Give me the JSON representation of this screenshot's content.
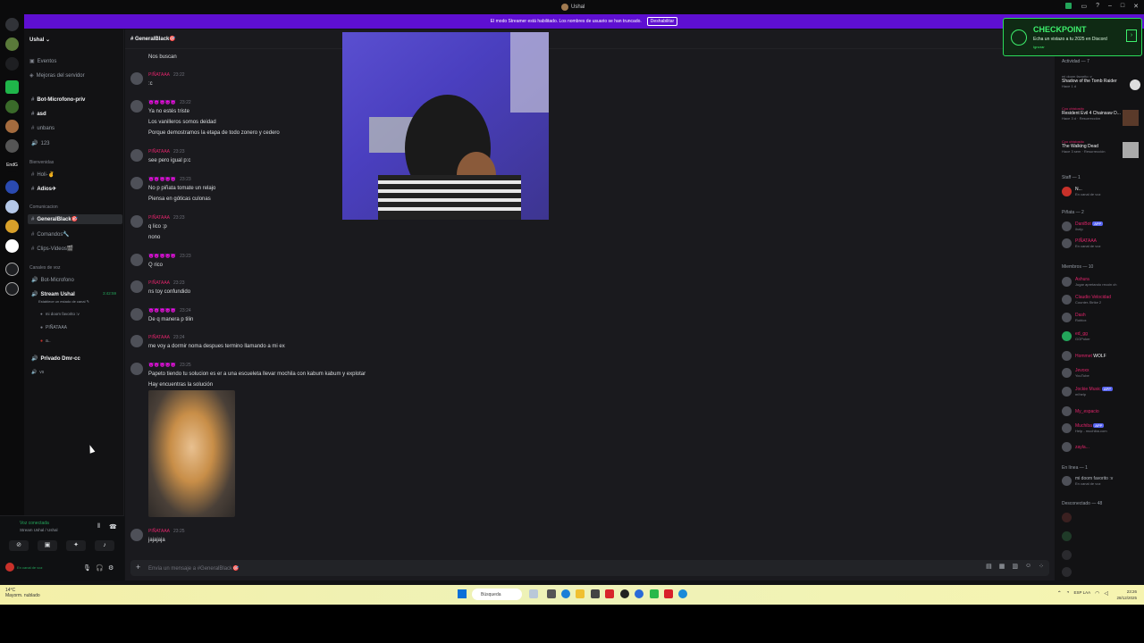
{
  "window": {
    "title": "Ushal"
  },
  "banner": {
    "text": "El modo Streamer está habilitado. Los nombres de usuario se han truncado.",
    "button": "Deshabilitar"
  },
  "server": {
    "name": "Ushal"
  },
  "channels": {
    "top": [
      {
        "label": "Eventos"
      },
      {
        "label": "Mejoras del servidor"
      }
    ],
    "text_top": [
      {
        "label": "Bot-Microfono-priv"
      },
      {
        "label": "asd"
      },
      {
        "label": "unbans"
      },
      {
        "label": "123"
      }
    ],
    "cat_bienvenidas": "Bienvenidas",
    "bienvenidas": [
      {
        "label": "Holi-✌"
      },
      {
        "label": "Adios✈"
      }
    ],
    "cat_comunicacion": "Comunicacion",
    "comunicacion": [
      {
        "label": "GeneralBlack🎯"
      },
      {
        "label": "Comandos🔧"
      },
      {
        "label": "Clips-Videos🎬"
      }
    ],
    "cat_voz": "Canales de voz",
    "voz": [
      {
        "label": "Bot-Microfono"
      },
      {
        "label": "Stream Ushal",
        "time": "3:42:59"
      }
    ],
    "voz_status": "Establece un estado de canal ✎",
    "voz_users": [
      {
        "label": "mi doom favorito :v"
      },
      {
        "label": "PIÑATAAA"
      },
      {
        "label": "a.."
      }
    ],
    "private": {
      "label": "Privado Dmr-cc"
    },
    "vs": "vs"
  },
  "voice_panel": {
    "status": "Voz conectada",
    "channel": "Stream Ushal / Ushal",
    "user_status": "En canal de voz"
  },
  "chat": {
    "channel_title": "GeneralBlack🎯",
    "composer_placeholder": "Envía un mensaje a #GeneralBlack🎯",
    "messages": [
      {
        "text": "Nos buscan"
      },
      {
        "name": "PIÑATAAA",
        "time": "23:22",
        "text": ":c"
      },
      {
        "name": "😈😈😈😈😈",
        "time": "23:22",
        "lines": [
          "Ya no estés triste",
          "Los vanilleros somos deidad",
          "Porque demostramos la etapa de todo zonero y cedero"
        ]
      },
      {
        "name": "PIÑATAAA",
        "time": "23:23",
        "text": "see pero igual p:c"
      },
      {
        "name": "😈😈😈😈😈",
        "time": "23:23",
        "lines": [
          "No p piñata tomate un relajo",
          "Piensa en góticas culonas"
        ]
      },
      {
        "name": "PIÑATAAA",
        "time": "23:23",
        "lines": [
          "q lico :p",
          "nono"
        ]
      },
      {
        "name": "😈😈😈😈😈",
        "time": "23:23",
        "text": "Q rico"
      },
      {
        "name": "PIÑATAAA",
        "time": "23:23",
        "text": "ns toy confundido"
      },
      {
        "name": "😈😈😈😈😈",
        "time": "23:24",
        "text": "De q manera p tilin"
      },
      {
        "name": "PIÑATAAA",
        "time": "23:24",
        "text": "me voy a dormir noma despues termino llamando a mi ex"
      },
      {
        "name": "😈😈😈😈😈",
        "time": "23:25",
        "lines": [
          "Papeto tiendo tu solucion es er a una escueleta llevar mochila con kabum kabum y explotar",
          "Hay encuentras la solución"
        ]
      },
      {
        "name": "PIÑATAAA",
        "time": "23:25",
        "text": "jajajaja"
      }
    ]
  },
  "checkpoint": {
    "title": "CHECKPOINT",
    "subtitle": "Echa un vistazo a tu 2025 en Discord",
    "dismiss": "Ignorar",
    "arrow": "›"
  },
  "members": {
    "activity_head": "Actividad — 7",
    "activities": [
      {
        "user": "mi doom favorito :v",
        "title": "Shadow of the Tomb Raider",
        "sub": "Hace 1 d"
      },
      {
        "user": "Cyo chistosito",
        "title": "Resident Evil 4 Chainsaw D...",
        "sub": "Hace 3 d · Resurrección"
      },
      {
        "user": "Cyo chistosito",
        "title": "The Walking Dead",
        "sub": "Hace 3 sem · Resurrección"
      }
    ],
    "staff_head": "Staff — 1",
    "staff": [
      {
        "name": "N...",
        "sub": "En canal de voz"
      }
    ],
    "pinata_head": "Piñata — 2",
    "pinata": [
      {
        "name": "DaniBot",
        "badge": "APP",
        "sub": "/help"
      },
      {
        "name": "PIÑATAAA",
        "sub": "En canal de voz"
      }
    ],
    "miembros_head": "Miembros — 10",
    "miembros": [
      {
        "name": "Ashura",
        "sub": "Jugar apretando recoin ch"
      },
      {
        "name": "Claudio Velocidad",
        "sub": "Counter-Strike 2"
      },
      {
        "name": "Dash",
        "sub": "Roblox"
      },
      {
        "name": "ed_gg",
        "sub": "GGPoker"
      },
      {
        "name": "Hommet",
        "sub": "WOLF"
      },
      {
        "name": "Jevoxx",
        "sub": "YouTube"
      },
      {
        "name": "Jockie Music",
        "badge": "APP",
        "sub": "m!help"
      },
      {
        "name": "My_espacio",
        "sub": ""
      },
      {
        "name": "Muchiba",
        "badge": "APP",
        "sub": "Help - muchiba.com"
      },
      {
        "name": "zayla...",
        "sub": ""
      }
    ],
    "online_head": "En línea — 1",
    "online": [
      {
        "name": "mi doom favorito :v",
        "sub": "En canal de voz"
      }
    ],
    "offline_head": "Desconectado — 48"
  },
  "taskbar": {
    "weather_temp": "14°C",
    "weather_desc": "Mayorm. nublado",
    "search": "Búsqueda",
    "time": "23:26",
    "date": "28/12/2025",
    "lang": "ESP LAA"
  },
  "colors": {
    "accent": "#5e0fd1",
    "pinata": "#e0246a",
    "emoji_user": "#9b59b6",
    "online": "#23a55a",
    "checkpoint": "#3ef06d"
  }
}
